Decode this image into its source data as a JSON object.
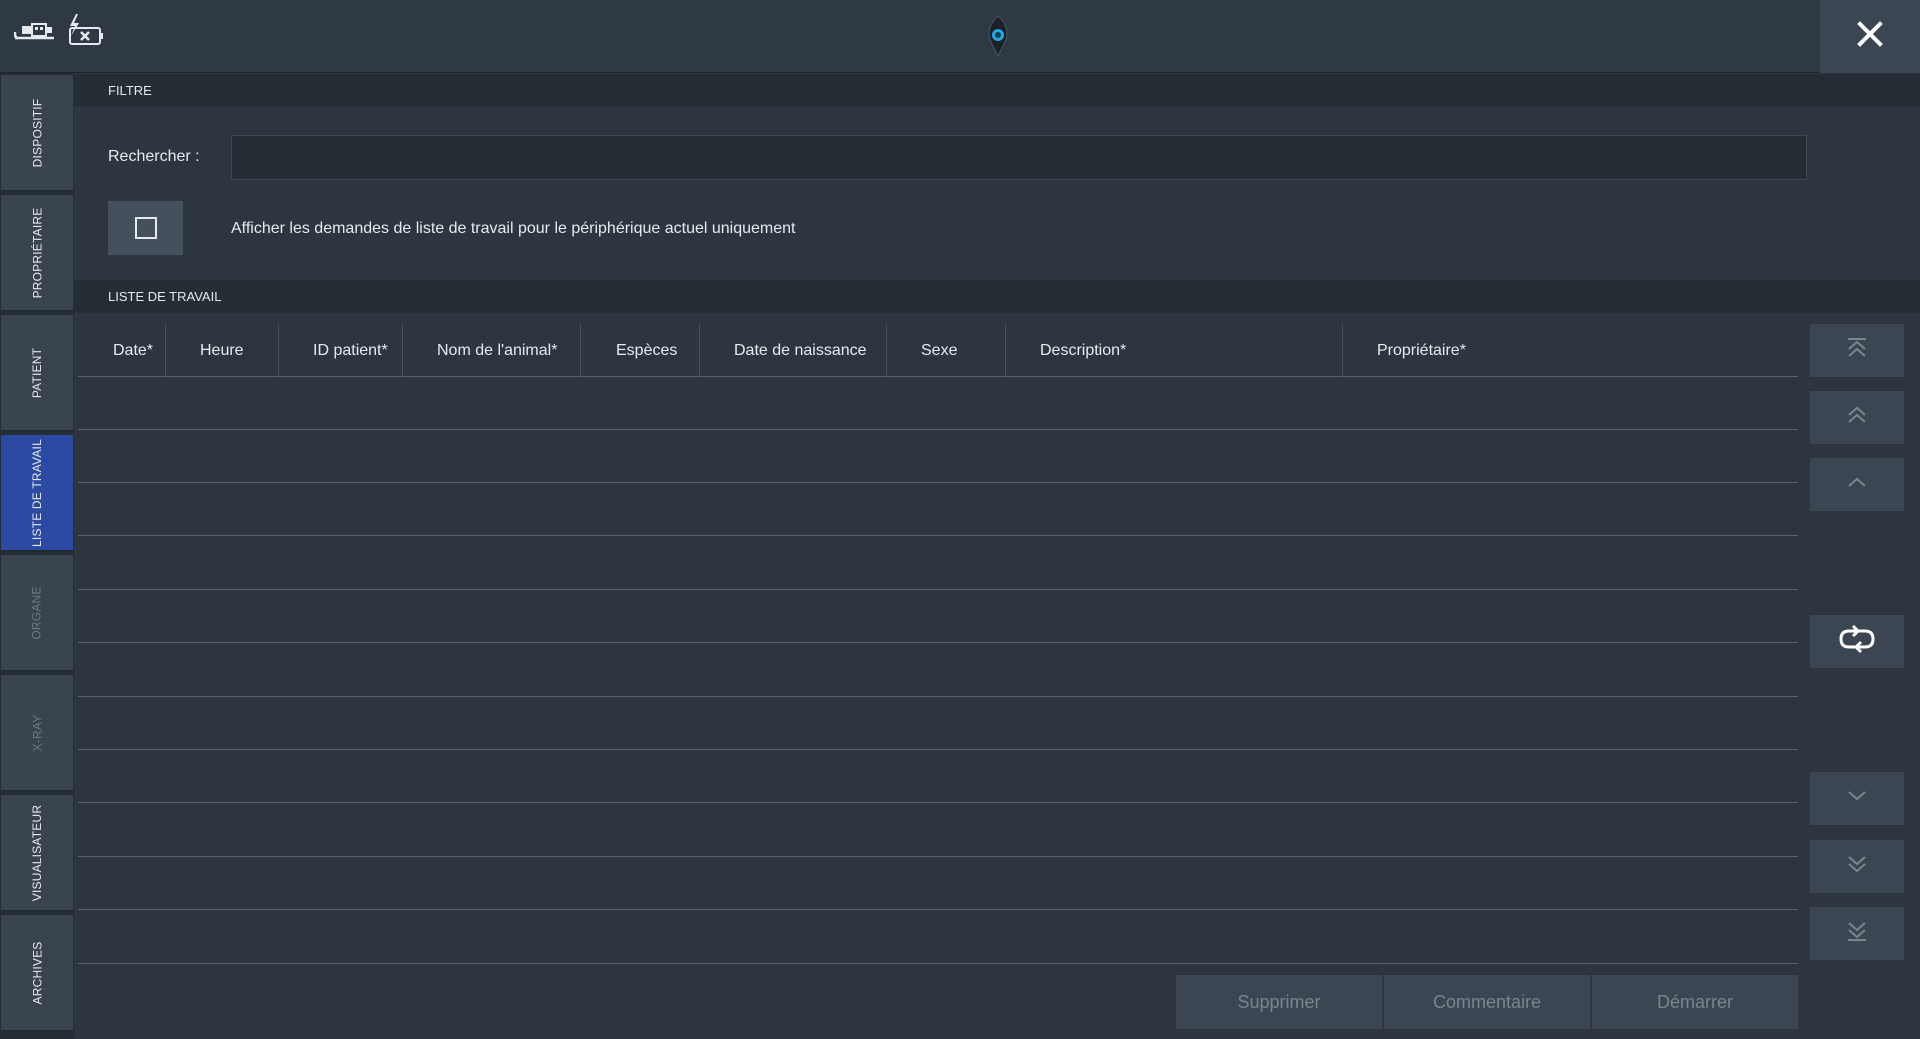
{
  "header": {
    "left_icons": [
      "usb-connection-icon",
      "battery-disconnected-icon"
    ],
    "center_icon": "app-logo-icon",
    "close_icon": "close-icon"
  },
  "sidebar": {
    "items": [
      {
        "label": "DISPOSITIF",
        "state": "normal"
      },
      {
        "label": "PROPRIÉTAIRE",
        "state": "normal"
      },
      {
        "label": "PATIENT",
        "state": "normal"
      },
      {
        "label": "LISTE DE TRAVAIL",
        "state": "active"
      },
      {
        "label": "ORGANE",
        "state": "disabled"
      },
      {
        "label": "X-RAY",
        "state": "disabled"
      },
      {
        "label": "VISUALISATEUR",
        "state": "normal"
      },
      {
        "label": "ARCHIVES",
        "state": "normal"
      }
    ]
  },
  "filter": {
    "section_title": "FILTRE",
    "search_label": "Rechercher :",
    "search_value": "",
    "search_placeholder": "",
    "checkbox_checked": false,
    "checkbox_label": "Afficher les demandes de liste de travail pour le périphérique actuel uniquement"
  },
  "worklist": {
    "section_title": "LISTE DE TRAVAIL",
    "columns": [
      "Date*",
      "Heure",
      "ID patient*",
      "Nom de l'animal*",
      "Espèces",
      "Date de naissance",
      "Sexe",
      "Description*",
      "Propriétaire*"
    ],
    "rows": []
  },
  "nav_buttons": {
    "top": "double-chevron-top-icon",
    "page_up": "double-chevron-up-icon",
    "up": "chevron-up-icon",
    "refresh": "refresh-icon",
    "down": "chevron-down-icon",
    "page_down": "double-chevron-down-icon",
    "bottom": "double-chevron-bottom-icon"
  },
  "actions": {
    "delete_label": "Supprimer",
    "comment_label": "Commentaire",
    "start_label": "Démarrer"
  },
  "colors": {
    "background": "#2d3640",
    "sidebar_active": "#2b4aa3",
    "header_strip": "#252d35",
    "button": "#3b4652"
  }
}
